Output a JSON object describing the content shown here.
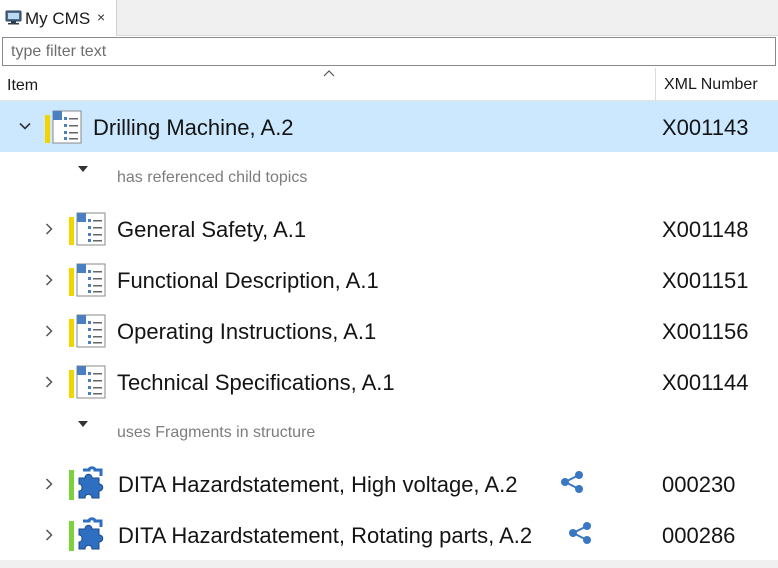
{
  "tab": {
    "title": "My CMS",
    "close": "×",
    "icon": "cms-view-icon"
  },
  "filter": {
    "placeholder": "type filter text",
    "value": ""
  },
  "columns": {
    "item": "Item",
    "xml_number": "XML Number",
    "sort_indicator": "^"
  },
  "root": {
    "name": "Drilling Machine, A.2",
    "xml": "X001143",
    "expanded": true,
    "selected": true,
    "icon": "document-topic-icon"
  },
  "groups": [
    {
      "label": "has referenced child topics",
      "items": [
        {
          "name": "General Safety, A.1",
          "xml": "X001148",
          "icon": "document-topic-icon"
        },
        {
          "name": "Functional Description, A.1",
          "xml": "X001151",
          "icon": "document-topic-icon"
        },
        {
          "name": "Operating Instructions, A.1",
          "xml": "X001156",
          "icon": "document-topic-icon"
        },
        {
          "name": "Technical Specifications, A.1",
          "xml": "X001144",
          "icon": "document-topic-icon"
        }
      ]
    },
    {
      "label": "uses Fragments in structure",
      "items": [
        {
          "name": "DITA Hazardstatement, High voltage,  A.2",
          "xml": "000230",
          "icon": "puzzle-fragment-icon",
          "shared": true
        },
        {
          "name": "DITA Hazardstatement, Rotating parts, A.2",
          "xml": "000286",
          "icon": "puzzle-fragment-icon",
          "shared": true
        }
      ]
    }
  ],
  "colors": {
    "selection": "#cce8ff",
    "topic_marker": "#f2d400",
    "fragment_marker": "#7bd23b",
    "share_icon": "#3b78c4",
    "group_label": "#7d7d7d"
  }
}
